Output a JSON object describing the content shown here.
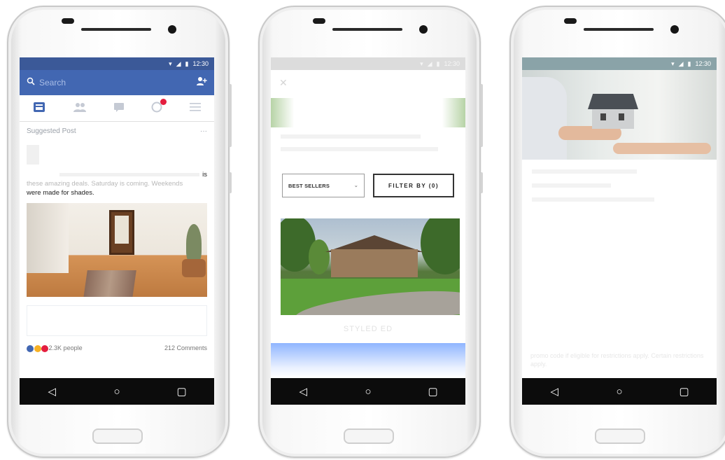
{
  "status": {
    "time": "12:30"
  },
  "nav": {
    "back": "◁",
    "home": "○",
    "recents": "▢"
  },
  "phone1": {
    "search_placeholder": "Search",
    "suggested_label": "Suggested Post",
    "more": "···",
    "caption_tail": "is",
    "caption_line2": "these amazing deals. Saturday is coming. Weekends",
    "caption_line3": "were made for shades.",
    "reactions_count": "2.3K people",
    "comments": "212 Comments"
  },
  "phone2": {
    "sort_label": "BEST SELLERS",
    "filter_label": "FILTER BY (0)",
    "styled_label": "STYLED ED"
  },
  "phone3": {
    "bottom_text": "promo code if eligible for restrictions apply. Certain restrictions apply."
  },
  "colors": {
    "facebook_blue": "#4267b2",
    "notification_red": "#e41e3f",
    "nav_black": "#0c0c0c"
  }
}
